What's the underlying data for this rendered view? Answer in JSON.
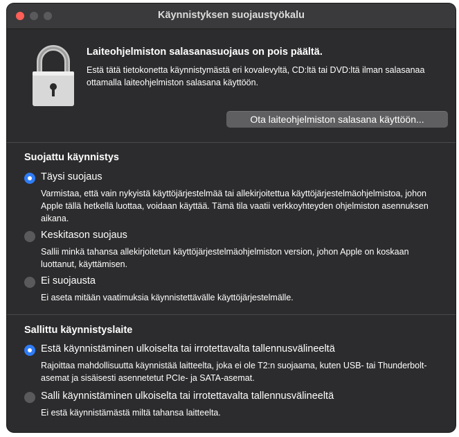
{
  "window": {
    "title": "Käynnistyksen suojaustyökalu"
  },
  "firmware": {
    "icon": "lock-icon",
    "heading": "Laiteohjelmiston salasanasuojaus on pois päältä.",
    "description": "Estä tätä tietokonetta käynnistymästä eri kovalevyltä, CD:ltä tai DVD:ltä ilman salasanaa ottamalla laiteohjelmiston salasana käyttöön.",
    "button_label": "Ota laiteohjelmiston salasana käyttöön..."
  },
  "secure_boot": {
    "heading": "Suojattu käynnistys",
    "options": [
      {
        "label": "Täysi suojaus",
        "selected": true,
        "description": "Varmistaa, että vain nykyistä käyttöjärjestelmää tai allekirjoitettua käyttöjärjestelmäohjelmistoa, johon Apple tällä hetkellä luottaa, voidaan käyttää. Tämä tila vaatii verkkoyhteyden ohjelmiston asennuksen aikana."
      },
      {
        "label": "Keskitason suojaus",
        "selected": false,
        "description": "Sallii minkä tahansa allekirjoitetun käyttöjärjestelmäohjelmiston version, johon Apple on koskaan luottanut, käyttämisen."
      },
      {
        "label": "Ei suojausta",
        "selected": false,
        "description": "Ei aseta mitään vaatimuksia käynnistettävälle käyttöjärjestelmälle."
      }
    ]
  },
  "allowed_boot_media": {
    "heading": "Sallittu käynnistyslaite",
    "options": [
      {
        "label": "Estä käynnistäminen ulkoiselta tai irrotettavalta tallennusvälineeltä",
        "selected": true,
        "description": "Rajoittaa mahdollisuutta käynnistää laitteelta, joka ei ole T2:n suojaama, kuten USB- tai Thunderbolt-asemat ja sisäisesti asennetetut PCIe- ja SATA-asemat."
      },
      {
        "label": "Salli käynnistäminen ulkoiselta tai irrotettavalta tallennusvälineeltä",
        "selected": false,
        "description": "Ei estä käynnistämästä miltä tahansa laitteelta."
      }
    ]
  },
  "colors": {
    "window_bg": "#2c2c2e",
    "accent": "#2f7cf6"
  }
}
